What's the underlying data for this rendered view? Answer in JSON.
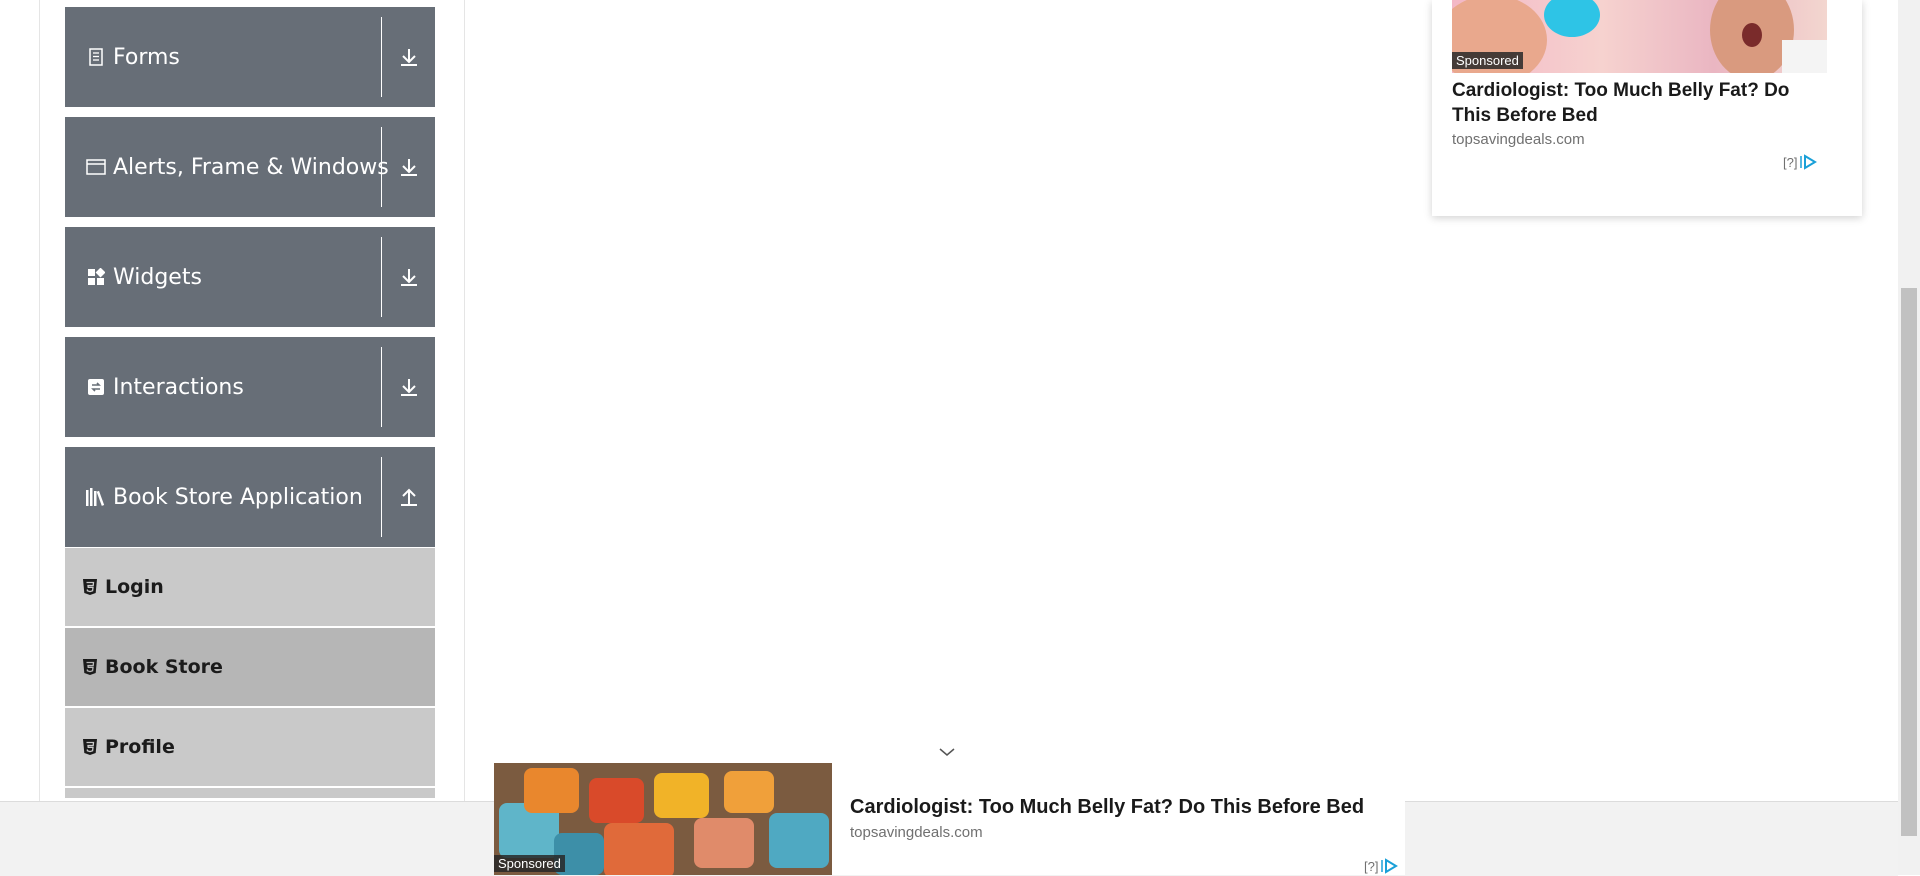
{
  "sidebar": {
    "groups": [
      {
        "title": "Forms",
        "icon": "form-icon",
        "toggle_icon": "download-arrow-icon",
        "expanded": false
      },
      {
        "title": "Alerts, Frame & Windows",
        "icon": "window-icon",
        "toggle_icon": "download-arrow-icon",
        "expanded": false
      },
      {
        "title": "Widgets",
        "icon": "widgets-icon",
        "toggle_icon": "download-arrow-icon",
        "expanded": false
      },
      {
        "title": "Interactions",
        "icon": "interactions-icon",
        "toggle_icon": "download-arrow-icon",
        "expanded": false
      },
      {
        "title": "Book Store Application",
        "icon": "books-icon",
        "toggle_icon": "upload-arrow-icon",
        "expanded": true
      }
    ],
    "book_store_items": [
      {
        "label": "Login",
        "icon": "html5-icon",
        "active": false
      },
      {
        "label": "Book Store",
        "icon": "html5-icon",
        "active": true
      },
      {
        "label": "Profile",
        "icon": "html5-icon",
        "active": false
      }
    ]
  },
  "right_ad": {
    "sponsored": "Sponsored",
    "headline": "Cardiologist: Too Much Belly Fat? Do This Before Bed",
    "domain": "topsavingdeals.com",
    "help": "[?]"
  },
  "bottom_ad": {
    "sponsored": "Sponsored",
    "headline": "Cardiologist: Too Much Belly Fat? Do This Before Bed",
    "domain": "topsavingdeals.com",
    "help": "[?]"
  },
  "colors": {
    "group_header_bg": "#676e77",
    "sub_item_bg": "#c9c9c9",
    "sub_item_active_bg": "#b6b6b6",
    "adchoice_blue": "#1aa0d8"
  }
}
